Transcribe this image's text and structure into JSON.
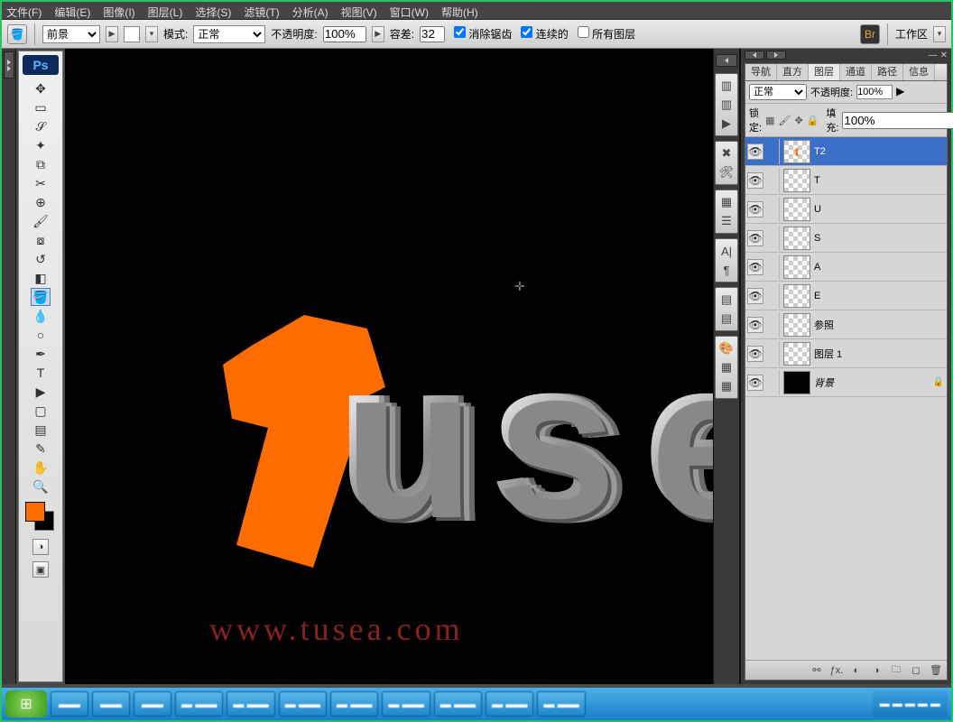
{
  "menu": {
    "file": "文件(F)",
    "edit": "编辑(E)",
    "image": "图像(I)",
    "layer": "图层(L)",
    "select": "选择(S)",
    "filter": "滤镜(T)",
    "analyze": "分析(A)",
    "view": "视图(V)",
    "window": "窗口(W)",
    "help": "帮助(H)"
  },
  "options": {
    "fgLabel": "前景",
    "modeLabel": "模式:",
    "mode": "正常",
    "opacityLabel": "不透明度:",
    "opacity": "100%",
    "toleranceLabel": "容差:",
    "tolerance": "32",
    "antialias": "消除锯齿",
    "contiguous": "连续的",
    "allLayers": "所有图层",
    "workspace": "工作区"
  },
  "canvas": {
    "watermark": "www.tusea.com"
  },
  "panel": {
    "tabs": {
      "nav": "导航",
      "histo": "直方",
      "layers": "图层",
      "channels": "通道",
      "paths": "路径",
      "info": "信息"
    },
    "blend": "正常",
    "opacityLabel": "不透明度:",
    "opacity": "100%",
    "lockLabel": "锁定:",
    "fillLabel": "填充:",
    "fill": "100%"
  },
  "layers": [
    {
      "name": "T2",
      "selected": true,
      "thumb": "t"
    },
    {
      "name": "T",
      "thumb": "checker"
    },
    {
      "name": "U",
      "thumb": "checker"
    },
    {
      "name": "S",
      "thumb": "checker"
    },
    {
      "name": "A",
      "thumb": "checker"
    },
    {
      "name": "E",
      "thumb": "checker"
    },
    {
      "name": "参照",
      "thumb": "checker"
    },
    {
      "name": "图层 1",
      "thumb": "checker"
    },
    {
      "name": "背景",
      "thumb": "black",
      "locked": true,
      "italic": true
    }
  ]
}
